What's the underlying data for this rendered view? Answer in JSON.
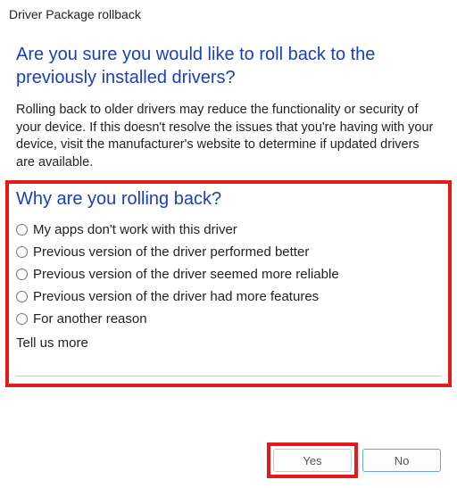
{
  "window": {
    "title": "Driver Package rollback"
  },
  "main": {
    "heading": "Are you sure you would like to roll back to the previously installed drivers?",
    "body": "Rolling back to older drivers may reduce the functionality or security of your device. If this doesn't resolve the issues that you're having with your device, visit the manufacturer's website to determine if updated drivers are available."
  },
  "survey": {
    "heading": "Why are you rolling back?",
    "options": [
      "My apps don't work with this driver",
      "Previous version of the driver performed better",
      "Previous version of the driver seemed more reliable",
      "Previous version of the driver had more features",
      "For another reason"
    ],
    "tell_more_label": "Tell us more",
    "tell_more_value": ""
  },
  "buttons": {
    "yes": "Yes",
    "no": "No"
  },
  "annotations": {
    "survey_highlighted": true,
    "yes_highlighted": true,
    "highlight_color": "#e41b1b"
  }
}
